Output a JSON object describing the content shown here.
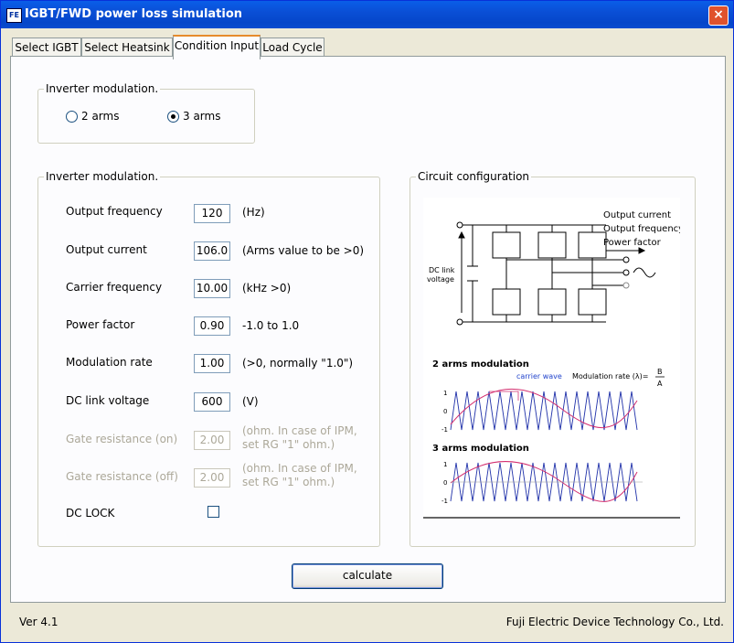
{
  "window": {
    "title": "IGBT/FWD power loss simulation",
    "icon": "app-icon",
    "close": "×"
  },
  "tabs": [
    {
      "label": "Select IGBT",
      "active": false
    },
    {
      "label": "Select Heatsink",
      "active": false
    },
    {
      "label": "Condition Input",
      "active": true
    },
    {
      "label": "Load Cycle",
      "active": false
    }
  ],
  "modulation_group": {
    "title": "Inverter modulation.",
    "options": [
      {
        "label": "2 arms",
        "selected": false
      },
      {
        "label": "3 arms",
        "selected": true
      }
    ]
  },
  "params_group": {
    "title": "Inverter modulation.",
    "fields": [
      {
        "label": "Output frequency",
        "value": "120",
        "unit": "(Hz)",
        "enabled": true
      },
      {
        "label": "Output current",
        "value": "106.0",
        "unit": "(Arms value to be >0)",
        "enabled": true
      },
      {
        "label": "Carrier frequency",
        "value": "10.00",
        "unit": "(kHz >0)",
        "enabled": true
      },
      {
        "label": "Power factor",
        "value": "0.90",
        "unit": "-1.0 to 1.0",
        "enabled": true
      },
      {
        "label": "Modulation rate",
        "value": "1.00",
        "unit": "(>0, normally \"1.0\")",
        "enabled": true
      },
      {
        "label": "DC link voltage",
        "value": "600",
        "unit": "(V)",
        "enabled": true
      },
      {
        "label": "Gate resistance (on)",
        "value": "2.00",
        "unit_line1": "(ohm. In case of IPM,",
        "unit_line2": "set RG \"1\" ohm.)",
        "enabled": false
      },
      {
        "label": "Gate resistance (off)",
        "value": "2.00",
        "unit_line1": "(ohm. In case of IPM,",
        "unit_line2": "set RG \"1\" ohm.)",
        "enabled": false
      }
    ],
    "dc_lock": {
      "label": "DC LOCK",
      "checked": false
    }
  },
  "circuit_group": {
    "title": "Circuit configuration",
    "diagram": {
      "dc_link": "DC link",
      "voltage": "voltage",
      "output_current": "Output current",
      "output_frequency": "Output frequency",
      "power_factor": "Power factor",
      "arms2_title": "2 arms modulation",
      "carrier_wave": "carrier wave",
      "mod_rate": "Modulation rate (λ)=",
      "frac_b": "B",
      "frac_a": "A",
      "arms3_title": "3 arms modulation",
      "tick_1": "1",
      "tick_0": "0",
      "tick_m1": "-1"
    }
  },
  "calculate_button": "calculate",
  "footer": {
    "version": "Ver 4.1",
    "company": "Fuji Electric Device Technology Co., Ltd."
  }
}
